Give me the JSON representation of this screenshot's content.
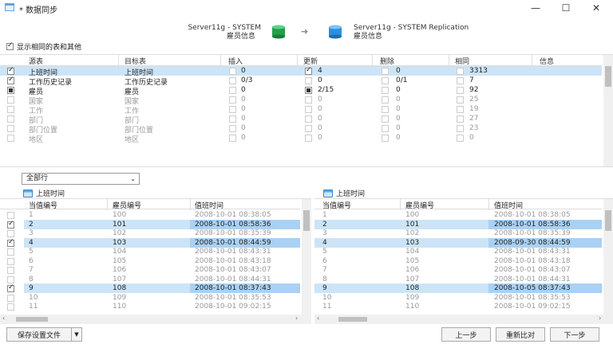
{
  "window": {
    "title": "* 数据同步",
    "min": "—",
    "max": "☐",
    "close": "✕"
  },
  "header": {
    "source_server": "Server11g - SYSTEM",
    "source_schema": "雇员信息",
    "target_server": "Server11g - SYSTEM Replication",
    "target_schema": "雇员信息",
    "arrow": "➜"
  },
  "show_same_label": "显示相同的表和其他",
  "table": {
    "columns": [
      "源表",
      "目标表",
      "插入",
      "更新",
      "删除",
      "相同",
      "信息"
    ],
    "rows": [
      {
        "chk": "on",
        "src": "上班时间",
        "dst": "上班时间",
        "ins": "0",
        "upd_chk": "on",
        "upd": "4",
        "del": "0",
        "same": "3313",
        "sel": true,
        "dim": false
      },
      {
        "chk": "on",
        "src": "工作历史记录",
        "dst": "工作历史记录",
        "ins": "0/3",
        "upd_chk": "off",
        "upd": "0",
        "del": "0/1",
        "same": "7",
        "sel": false,
        "dim": false
      },
      {
        "chk": "partial",
        "src": "雇员",
        "dst": "雇员",
        "ins": "0",
        "upd_chk": "partial",
        "upd": "2/15",
        "del": "0",
        "same": "92",
        "sel": false,
        "dim": false
      },
      {
        "chk": "off",
        "src": "国家",
        "dst": "国家",
        "ins": "0",
        "upd_chk": "off",
        "upd": "0",
        "del": "0",
        "same": "25",
        "sel": false,
        "dim": true
      },
      {
        "chk": "off",
        "src": "工作",
        "dst": "工作",
        "ins": "0",
        "upd_chk": "off",
        "upd": "0",
        "del": "0",
        "same": "19",
        "sel": false,
        "dim": true
      },
      {
        "chk": "off",
        "src": "部门",
        "dst": "部门",
        "ins": "0",
        "upd_chk": "off",
        "upd": "0",
        "del": "0",
        "same": "27",
        "sel": false,
        "dim": true
      },
      {
        "chk": "off",
        "src": "部门位置",
        "dst": "部门位置",
        "ins": "0",
        "upd_chk": "off",
        "upd": "0",
        "del": "0",
        "same": "23",
        "sel": false,
        "dim": true
      },
      {
        "chk": "off",
        "src": "地区",
        "dst": "地区",
        "ins": "0",
        "upd_chk": "off",
        "upd": "0",
        "del": "0",
        "same": "0",
        "sel": false,
        "dim": true
      }
    ]
  },
  "filter": {
    "value": "全部行",
    "arrow": "⌄"
  },
  "left_pane": {
    "title": "上班时间",
    "columns": [
      "当值编号",
      "雇员编号",
      "值班时间"
    ],
    "rows": [
      {
        "chk": false,
        "a": "1",
        "b": "100",
        "c": "2008-10-01 08:38:05",
        "hl": false,
        "dim": true
      },
      {
        "chk": true,
        "a": "2",
        "b": "101",
        "c": "2008-10-01 08:58:36",
        "hl": true,
        "dim": false
      },
      {
        "chk": false,
        "a": "3",
        "b": "102",
        "c": "2008-10-01 08:35:39",
        "hl": false,
        "dim": true
      },
      {
        "chk": true,
        "a": "4",
        "b": "103",
        "c": "2008-10-01 08:44:59",
        "hl": true,
        "dim": false
      },
      {
        "chk": false,
        "a": "5",
        "b": "104",
        "c": "2008-10-01 08:43:31",
        "hl": false,
        "dim": true
      },
      {
        "chk": false,
        "a": "6",
        "b": "105",
        "c": "2008-10-01 08:43:18",
        "hl": false,
        "dim": true
      },
      {
        "chk": false,
        "a": "7",
        "b": "106",
        "c": "2008-10-01 08:43:07",
        "hl": false,
        "dim": true
      },
      {
        "chk": false,
        "a": "8",
        "b": "107",
        "c": "2008-10-01 08:44:31",
        "hl": false,
        "dim": true
      },
      {
        "chk": true,
        "a": "9",
        "b": "108",
        "c": "2008-10-01 08:37:43",
        "hl": true,
        "dim": false
      },
      {
        "chk": false,
        "a": "10",
        "b": "109",
        "c": "2008-10-01 08:35:53",
        "hl": false,
        "dim": true
      },
      {
        "chk": false,
        "a": "11",
        "b": "110",
        "c": "2008-10-01 09:02:15",
        "hl": false,
        "dim": true
      }
    ]
  },
  "right_pane": {
    "title": "上班时间",
    "columns": [
      "当值编号",
      "雇员编号",
      "值班时间"
    ],
    "rows": [
      {
        "a": "1",
        "b": "100",
        "c": "2008-10-01 08:38:05",
        "hl": false,
        "dim": true
      },
      {
        "a": "2",
        "b": "101",
        "c": "2008-10-01 08:58:36",
        "hl": true,
        "dim": false
      },
      {
        "a": "3",
        "b": "102",
        "c": "2008-10-01 08:35:39",
        "hl": false,
        "dim": true
      },
      {
        "a": "4",
        "b": "103",
        "c": "2008-09-30 08:44:59",
        "hl": true,
        "dim": false
      },
      {
        "a": "5",
        "b": "104",
        "c": "2008-10-01 08:43:31",
        "hl": false,
        "dim": true
      },
      {
        "a": "6",
        "b": "105",
        "c": "2008-10-01 08:43:18",
        "hl": false,
        "dim": true
      },
      {
        "a": "7",
        "b": "106",
        "c": "2008-10-01 08:43:07",
        "hl": false,
        "dim": true
      },
      {
        "a": "8",
        "b": "107",
        "c": "2008-10-01 08:44:31",
        "hl": false,
        "dim": true
      },
      {
        "a": "9",
        "b": "108",
        "c": "2008-10-05 08:37:43",
        "hl": true,
        "dim": false
      },
      {
        "a": "10",
        "b": "109",
        "c": "2008-10-01 08:35:53",
        "hl": false,
        "dim": true
      },
      {
        "a": "11",
        "b": "110",
        "c": "2008-10-01 09:02:15",
        "hl": false,
        "dim": true
      }
    ]
  },
  "buttons": {
    "save": "保存设置文件",
    "prev": "上一步",
    "recompare": "重新比对",
    "next": "下一步"
  }
}
